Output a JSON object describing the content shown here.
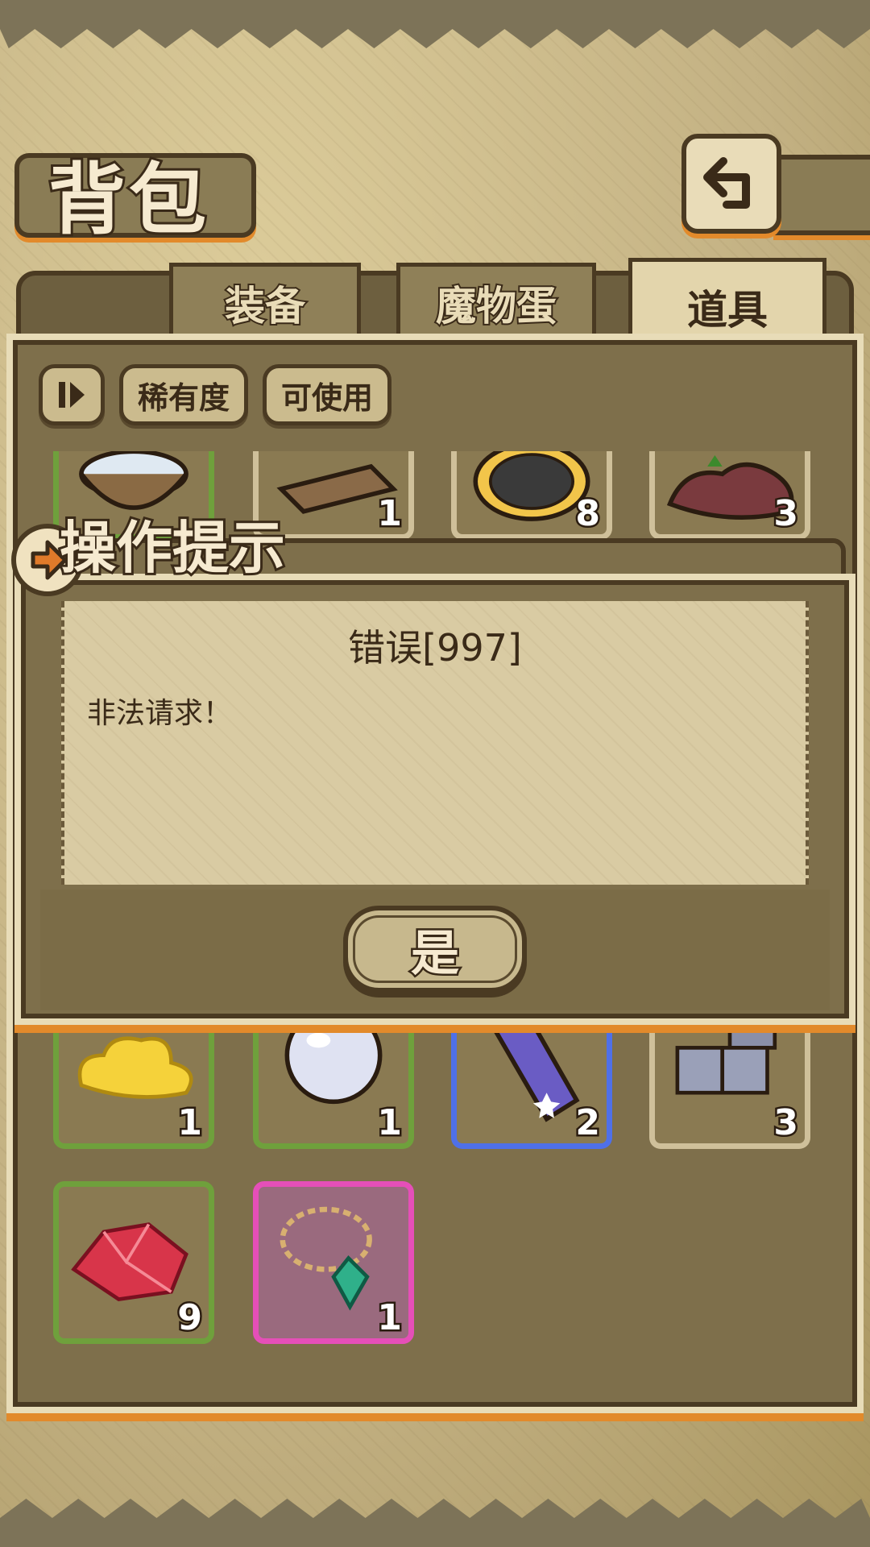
{
  "header": {
    "title": "背包",
    "back_icon": "back-arrow-icon"
  },
  "tabs": [
    {
      "label": "装备",
      "active": false
    },
    {
      "label": "魔物蛋",
      "active": false
    },
    {
      "label": "道具",
      "active": true
    }
  ],
  "filters": {
    "sort_icon": "sort-toggle-icon",
    "rarity_label": "稀有度",
    "usable_label": "可使用"
  },
  "items_top_row": [
    {
      "icon": "water-bowl-icon",
      "count": "",
      "rarity_color": "#6fa03c"
    },
    {
      "icon": "wood-plank-icon",
      "count": "1",
      "rarity_color": "#cfc09a"
    },
    {
      "icon": "net-pie-icon",
      "count": "8",
      "rarity_color": "#cfc09a"
    },
    {
      "icon": "dirt-pile-icon",
      "count": "3",
      "rarity_color": "#cfc09a"
    }
  ],
  "items_bottom": [
    {
      "icon": "gold-cloud-icon",
      "count": "1",
      "rarity_color": "#6fa03c"
    },
    {
      "icon": "pearl-icon",
      "count": "1",
      "rarity_color": "#6fa03c"
    },
    {
      "icon": "star-crystal-icon",
      "count": "2",
      "rarity_color": "#4f70e8"
    },
    {
      "icon": "stone-blocks-icon",
      "count": "3",
      "rarity_color": "#cfc09a"
    },
    {
      "icon": "red-gem-icon",
      "count": "9",
      "rarity_color": "#6fa03c"
    },
    {
      "icon": "emerald-necklace-icon",
      "count": "1",
      "rarity_color": "#e54fb8"
    }
  ],
  "dialog": {
    "title": "操作提示",
    "message_title": "错误[997]",
    "message": "非法请求！",
    "confirm_label": "是"
  }
}
